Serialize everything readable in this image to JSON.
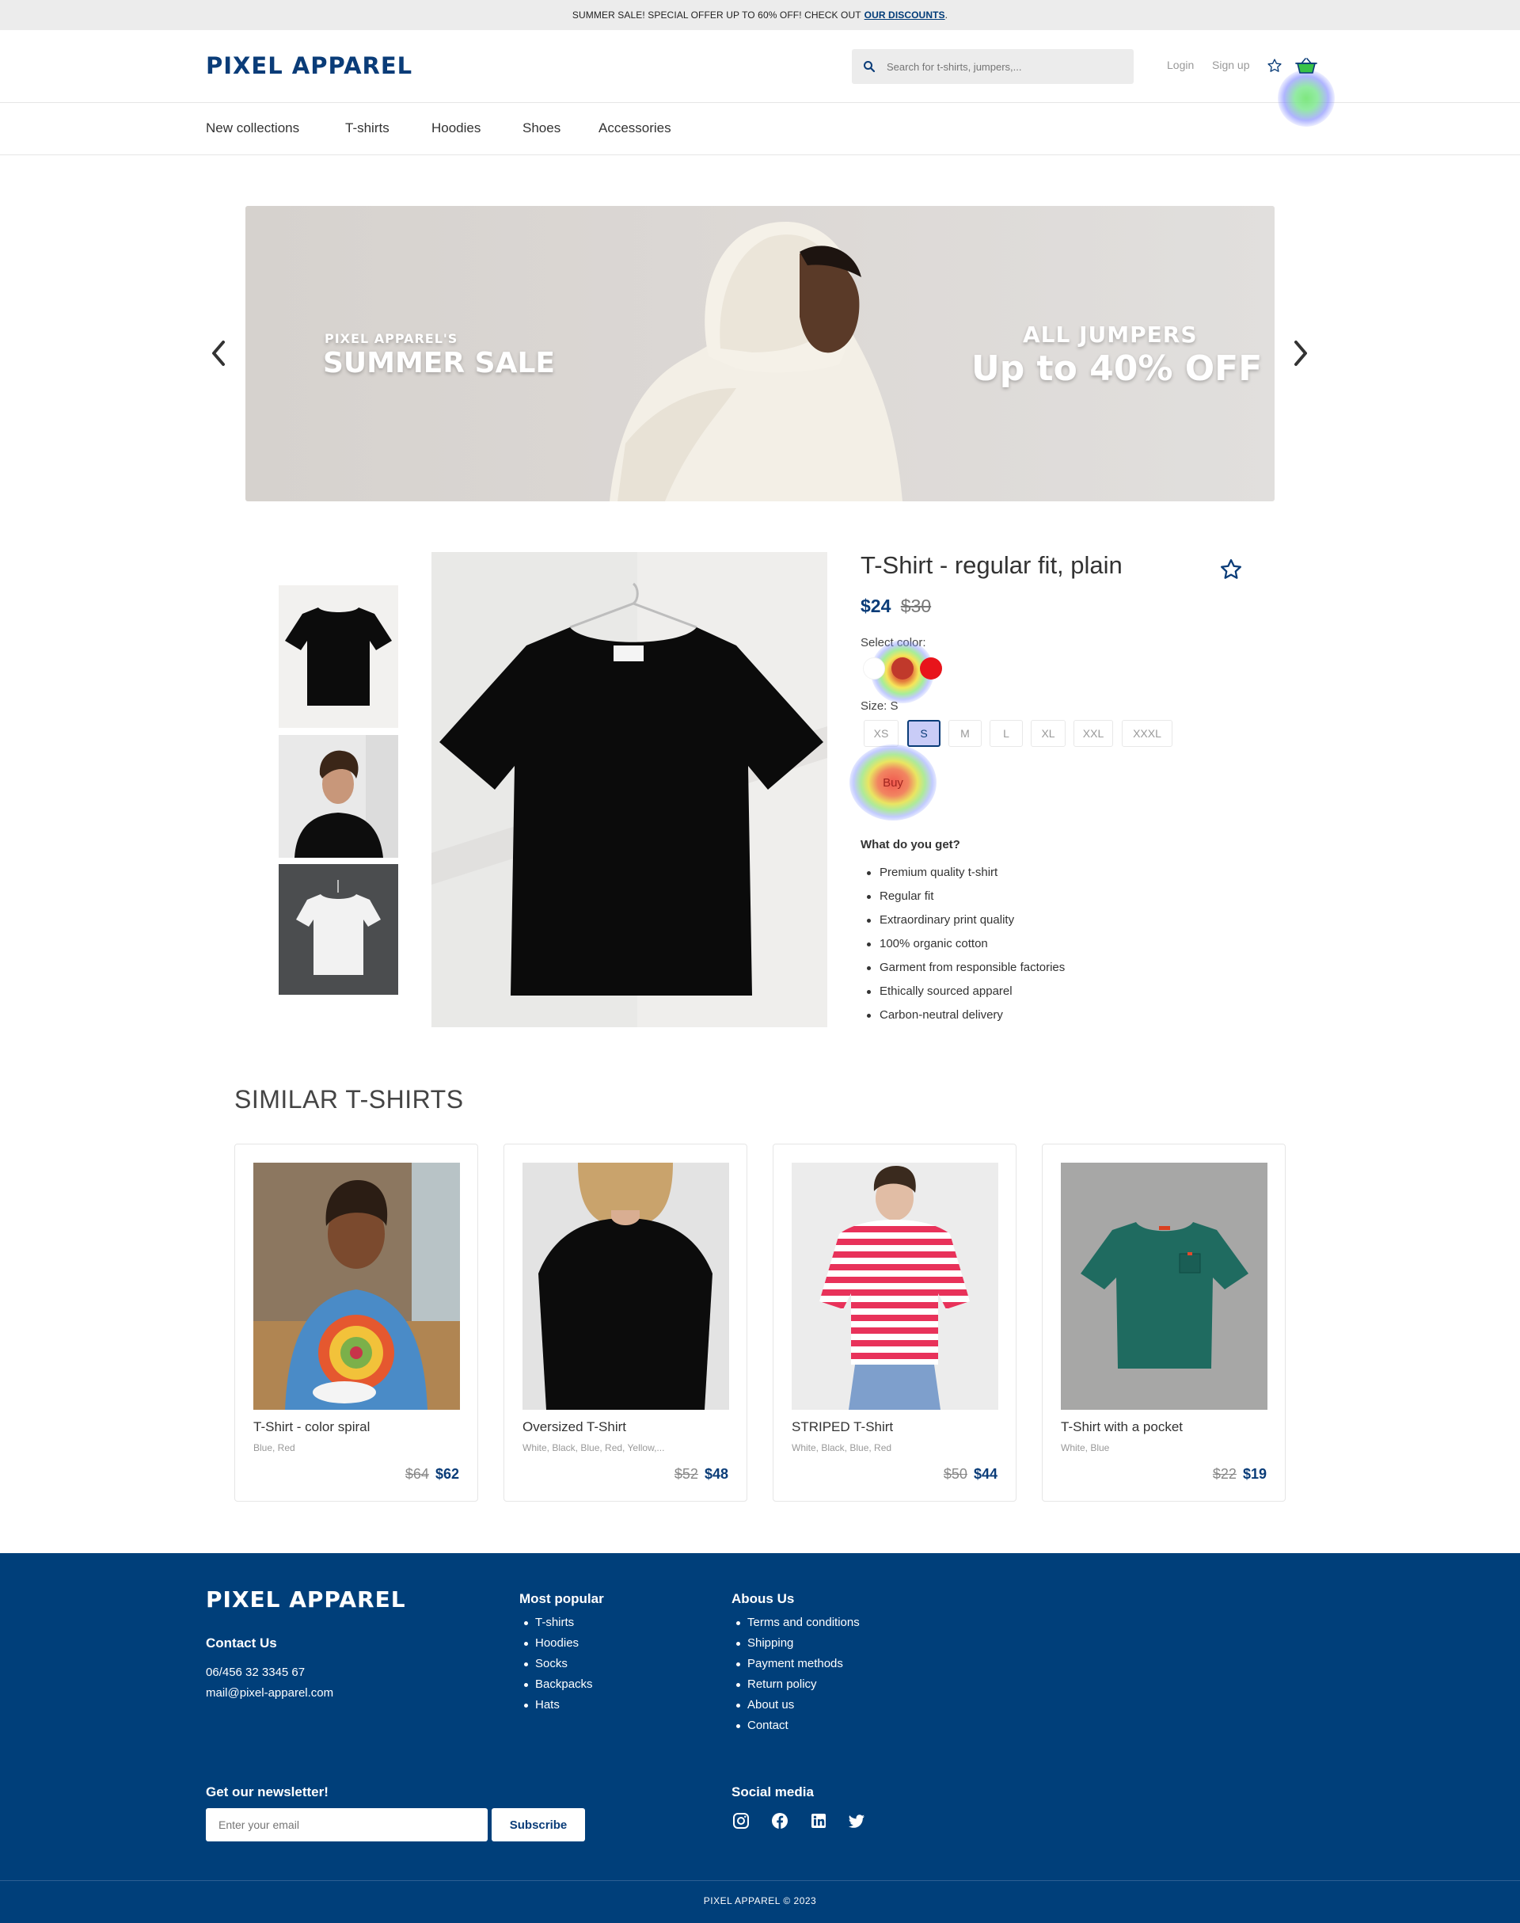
{
  "top_banner": {
    "text": "SUMMER SALE! SPECIAL OFFER UP TO 60% OFF! CHECK OUT",
    "link": "OUR DISCOUNTS",
    "period": "."
  },
  "header": {
    "logo": "PIXEL APPAREL",
    "search_placeholder": "Search for t-shirts, jumpers,...",
    "login": "Login",
    "signup": "Sign up",
    "icons": [
      "search-icon",
      "star-icon",
      "basket-icon"
    ]
  },
  "nav": {
    "items": [
      "New collections",
      "T-shirts",
      "Hoodies",
      "Shoes",
      "Accessories"
    ]
  },
  "hero": {
    "left_top": "PIXEL APPAREL'S",
    "left_main": "SUMMER SALE",
    "right_top": "ALL JUMPERS",
    "right_main": "Up to 40% OFF"
  },
  "product": {
    "title": "T-Shirt - regular fit, plain",
    "price_now": "$24",
    "price_old": "$30",
    "select_color_label": "Select color:",
    "colors": [
      "#ffffff",
      "#c0392b",
      "#e8141b"
    ],
    "size_label": "Size: S",
    "sizes": [
      "XS",
      "S",
      "M",
      "L",
      "XL",
      "XXL",
      "XXXL"
    ],
    "selected_size": "S",
    "buy_label": "Buy",
    "what_title": "What do you get?",
    "features": [
      "Premium quality t-shirt",
      "Regular fit",
      "Extraordinary print quality",
      "100% organic cotton",
      "Garment from responsible factories",
      "Ethically sourced apparel",
      "Carbon-neutral delivery"
    ]
  },
  "similar": {
    "title": "SIMILAR T-SHIRTS",
    "items": [
      {
        "name": "T-Shirt - color spiral",
        "colors": "Blue, Red",
        "old": "$64",
        "now": "$62"
      },
      {
        "name": "Oversized T-Shirt",
        "colors": "White, Black, Blue, Red, Yellow,...",
        "old": "$52",
        "now": "$48"
      },
      {
        "name": "STRIPED T-Shirt",
        "colors": "White, Black, Blue, Red",
        "old": "$50",
        "now": "$44"
      },
      {
        "name": "T-Shirt with a pocket",
        "colors": "White, Blue",
        "old": "$22",
        "now": "$19"
      }
    ]
  },
  "footer": {
    "logo": "PIXEL APPAREL",
    "contact_title": "Contact Us",
    "phone": "06/456 32 3345 67",
    "email": "mail@pixel-apparel.com",
    "popular_title": "Most popular",
    "popular": [
      "T-shirts",
      "Hoodies",
      "Socks",
      "Backpacks",
      "Hats"
    ],
    "about_title": "Abous Us",
    "about": [
      "Terms and conditions",
      "Shipping",
      "Payment methods",
      "Return policy",
      "About us",
      "Contact"
    ],
    "newsletter_title": "Get our newsletter!",
    "newsletter_placeholder": "Enter your email",
    "subscribe": "Subscribe",
    "social_title": "Social media",
    "social_icons": [
      "instagram-icon",
      "facebook-icon",
      "linkedin-icon",
      "twitter-icon"
    ],
    "copyright": "PIXEL APPAREL © 2023"
  },
  "colors": {
    "brand": "#0a3c78",
    "footer_bg": "#003f7a",
    "topbar_bg": "#ececec"
  }
}
